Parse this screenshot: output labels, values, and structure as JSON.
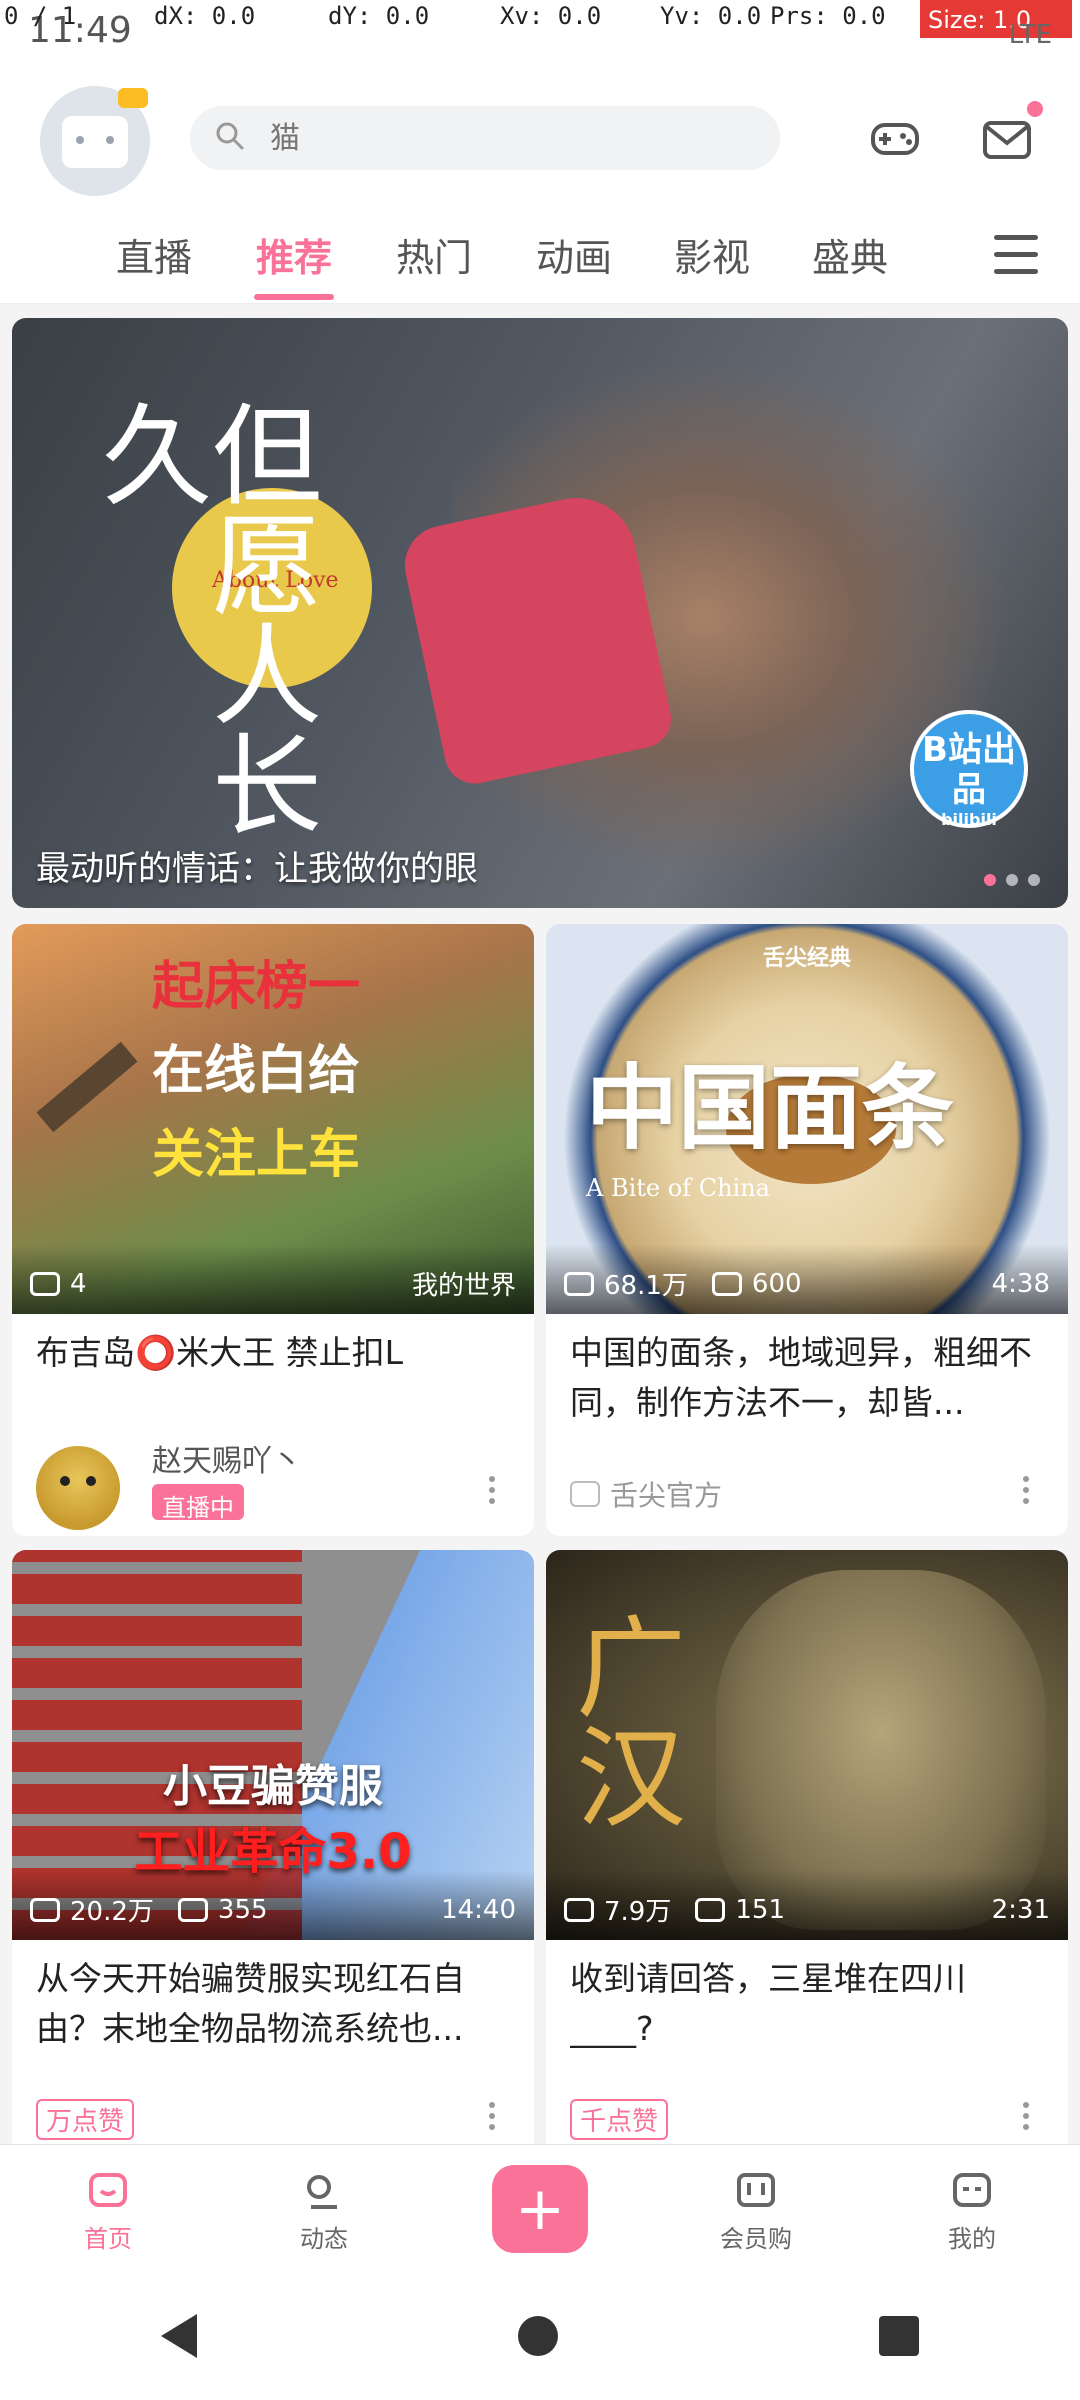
{
  "status_bar": {
    "time": "11:49",
    "debug": {
      "pointer": "0 / 1",
      "dx": "dX: 0.0",
      "dy": "dY: 0.0",
      "xv": "Xv: 0.0",
      "yv": "Yv: 0.0",
      "prs": "Prs: 0.0",
      "size": "Size: 1.0"
    },
    "network": "LTE"
  },
  "header": {
    "search_placeholder": "猫",
    "icons": [
      "avatar-icon",
      "search-icon",
      "game-icon",
      "mail-icon"
    ]
  },
  "tabs": [
    {
      "label": "直播"
    },
    {
      "label": "推荐"
    },
    {
      "label": "热门"
    },
    {
      "label": "动画"
    },
    {
      "label": "影视"
    },
    {
      "label": "盛典"
    }
  ],
  "banner": {
    "caption": "最动听的情话：让我做你的眼",
    "calligraphy": "但愿人长久",
    "sun_text": "About Love",
    "logo_text": "B站出品",
    "logo_sub": "bilibili"
  },
  "cards": [
    {
      "thumb_lines": [
        "起床榜一",
        "在线白给",
        "关注上车"
      ],
      "stat_views": "4",
      "stat_tag": "我的世界",
      "title": "布吉岛⭕米大王 禁止扣L",
      "live_name": "赵天赐吖丶",
      "live_badge": "直播中"
    },
    {
      "thumb_top": "舌尖经典",
      "thumb_big": "中国面条",
      "thumb_sub": "A Bite of China",
      "views": "68.1万",
      "danmaku": "600",
      "duration": "4:38",
      "title": "中国的面条，地域迥异，粗细不同，制作方法不一，却皆...",
      "uploader": "舌尖官方"
    },
    {
      "thumb_lines": [
        "小豆骗赞服",
        "工业革命3.0"
      ],
      "views": "20.2万",
      "danmaku": "355",
      "duration": "14:40",
      "title": "从今天开始骗赞服实现红石自由？末地全物品物流系统也...",
      "tag": "万点赞"
    },
    {
      "thumb_big": "广汉",
      "views": "7.9万",
      "danmaku": "151",
      "duration": "2:31",
      "title": "收到请回答，三星堆在四川____?",
      "tag": "千点赞"
    }
  ],
  "bottom_nav": [
    {
      "label": "首页",
      "icon": "home-icon"
    },
    {
      "label": "动态",
      "icon": "dynamic-icon"
    },
    {
      "label": "",
      "icon": "plus-icon"
    },
    {
      "label": "会员购",
      "icon": "shop-icon"
    },
    {
      "label": "我的",
      "icon": "profile-icon"
    }
  ],
  "colors": {
    "accent": "#fb7299",
    "text": "#222222",
    "muted": "#999999"
  }
}
